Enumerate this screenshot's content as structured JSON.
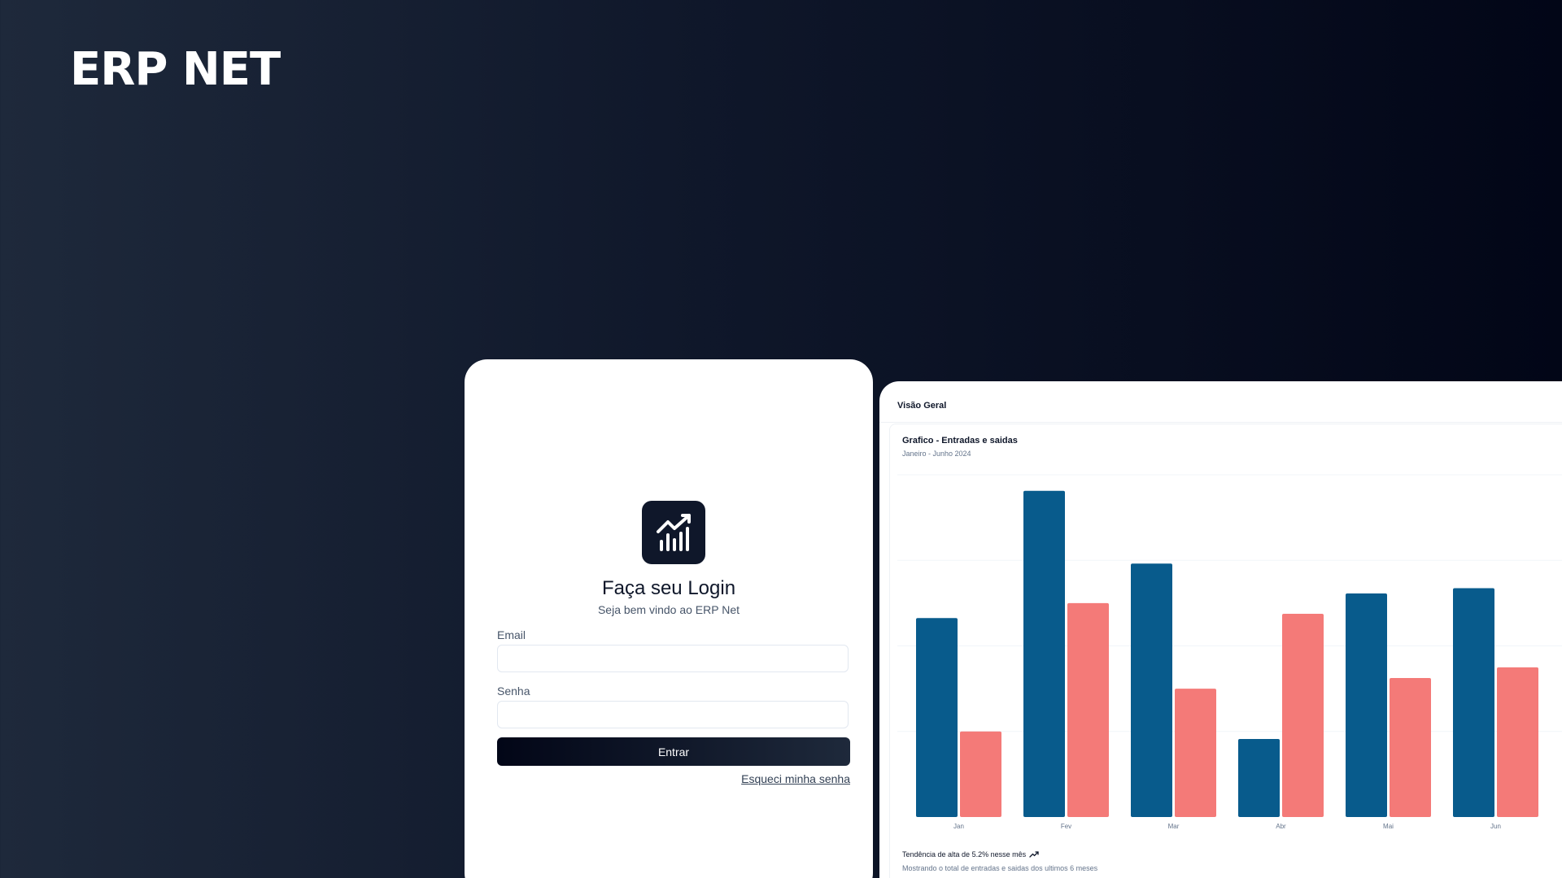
{
  "brand": {
    "title": "ERP NET"
  },
  "login": {
    "title": "Faça seu Login",
    "subtitle": "Seja bem vindo ao ERP Net",
    "email_label": "Email",
    "email_value": "",
    "password_label": "Senha",
    "password_value": "",
    "submit_label": "Entrar",
    "forgot_label": "Esqueci minha senha",
    "logo_icon": "chart-trending-up-icon"
  },
  "dashboard": {
    "header": "Visão Geral",
    "chart_title": "Grafico - Entradas e saidas",
    "chart_subtitle": "Janeiro - Junho 2024",
    "trend_text": "Tendência de alta de 5.2% nesse mês",
    "trend_icon": "trending-up-icon",
    "footer_text": "Mostrando o total de entradas e saidas dos ultimos 6 meses"
  },
  "chart_data": {
    "type": "bar",
    "categories": [
      "Jan",
      "Fev",
      "Mar",
      "Abr",
      "Mai",
      "Jun"
    ],
    "series": [
      {
        "color": "#085b8c",
        "values": [
          186,
          305,
          237,
          73,
          209,
          214
        ]
      },
      {
        "color": "#f47a78",
        "values": [
          80,
          200,
          120,
          190,
          130,
          140
        ]
      }
    ],
    "ylim": [
      0,
      320
    ],
    "grid": true,
    "legend": "none"
  }
}
